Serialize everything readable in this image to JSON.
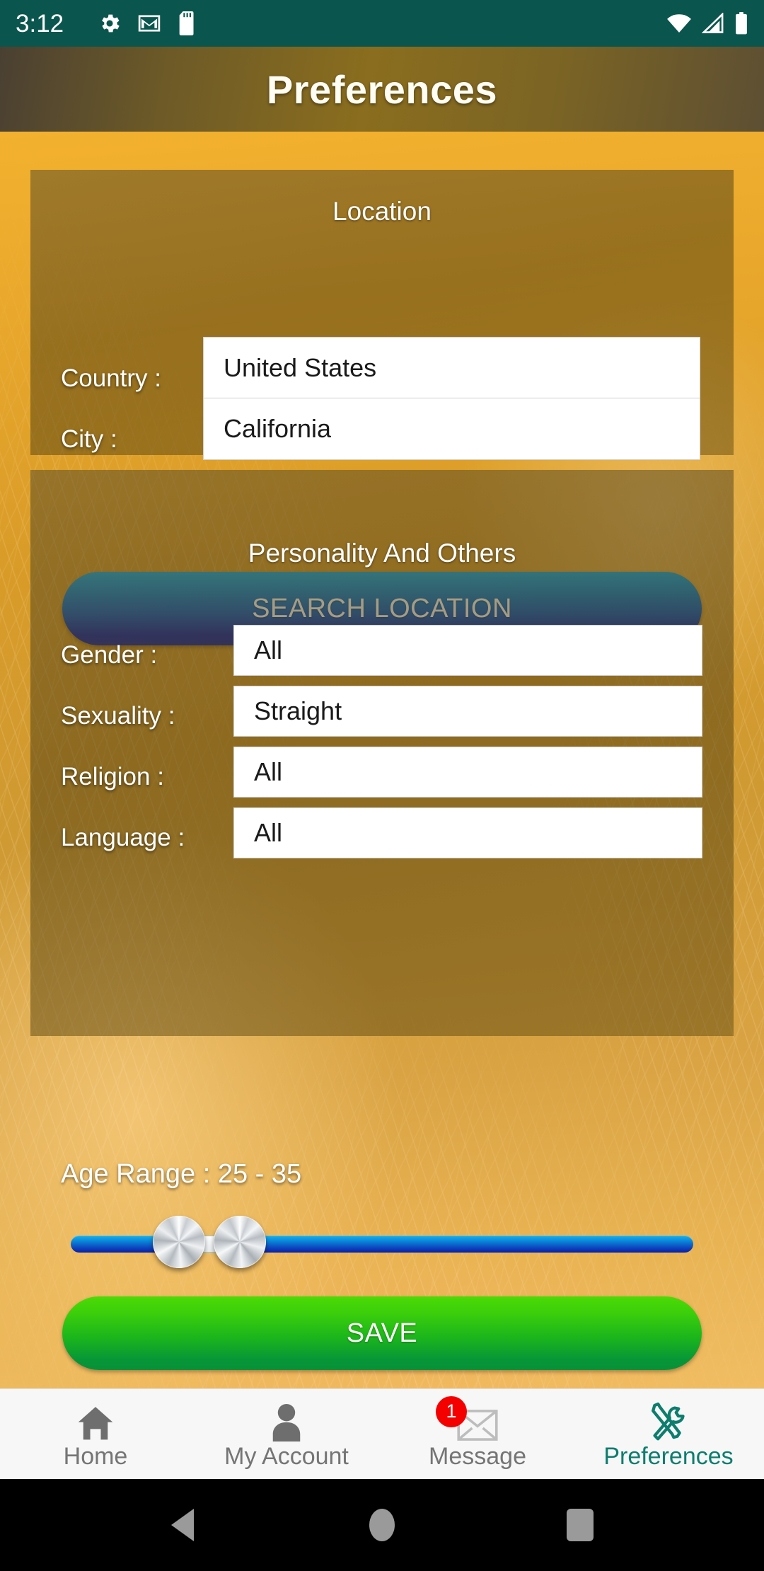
{
  "status_bar": {
    "time": "3:12",
    "left_icons": [
      "gear-icon",
      "gmail-icon",
      "sd-card-icon"
    ],
    "right_icons": [
      "wifi-icon",
      "cell-signal-icon",
      "battery-icon"
    ],
    "background_color": "#0a564e"
  },
  "app_bar": {
    "title": "Preferences"
  },
  "location_card": {
    "title": "Location",
    "fields": [
      {
        "label": "Country :",
        "value": "United States"
      },
      {
        "label": "City :",
        "value": "California"
      }
    ],
    "search_button": "SEARCH LOCATION",
    "search_button_color": "#0b55c0"
  },
  "personality_card": {
    "title": "Personality And Others",
    "fields": [
      {
        "label": "Gender :",
        "value": "All"
      },
      {
        "label": "Sexuality :",
        "value": "Straight"
      },
      {
        "label": "Religion :",
        "value": "All"
      },
      {
        "label": "Language :",
        "value": "All"
      }
    ],
    "age_range": {
      "label": "Age Range : 25 - 35",
      "min_value": 25,
      "max_value": 35,
      "track_color": "#0d46bd"
    },
    "save_button": "SAVE",
    "save_button_color": "#1cb61b"
  },
  "bottom_nav": {
    "active_color": "#0d7d6e",
    "inactive_color": "#757575",
    "items": [
      {
        "label": "Home",
        "icon": "home-icon",
        "active": false,
        "badge": ""
      },
      {
        "label": "My Account",
        "icon": "person-icon",
        "active": false,
        "badge": ""
      },
      {
        "label": "Message",
        "icon": "envelope-icon",
        "active": false,
        "badge": "1"
      },
      {
        "label": "Preferences",
        "icon": "tools-icon",
        "active": true,
        "badge": ""
      }
    ]
  },
  "system_nav": {
    "back": "back-triangle-icon",
    "home": "home-circle-icon",
    "recents": "recents-square-icon"
  }
}
